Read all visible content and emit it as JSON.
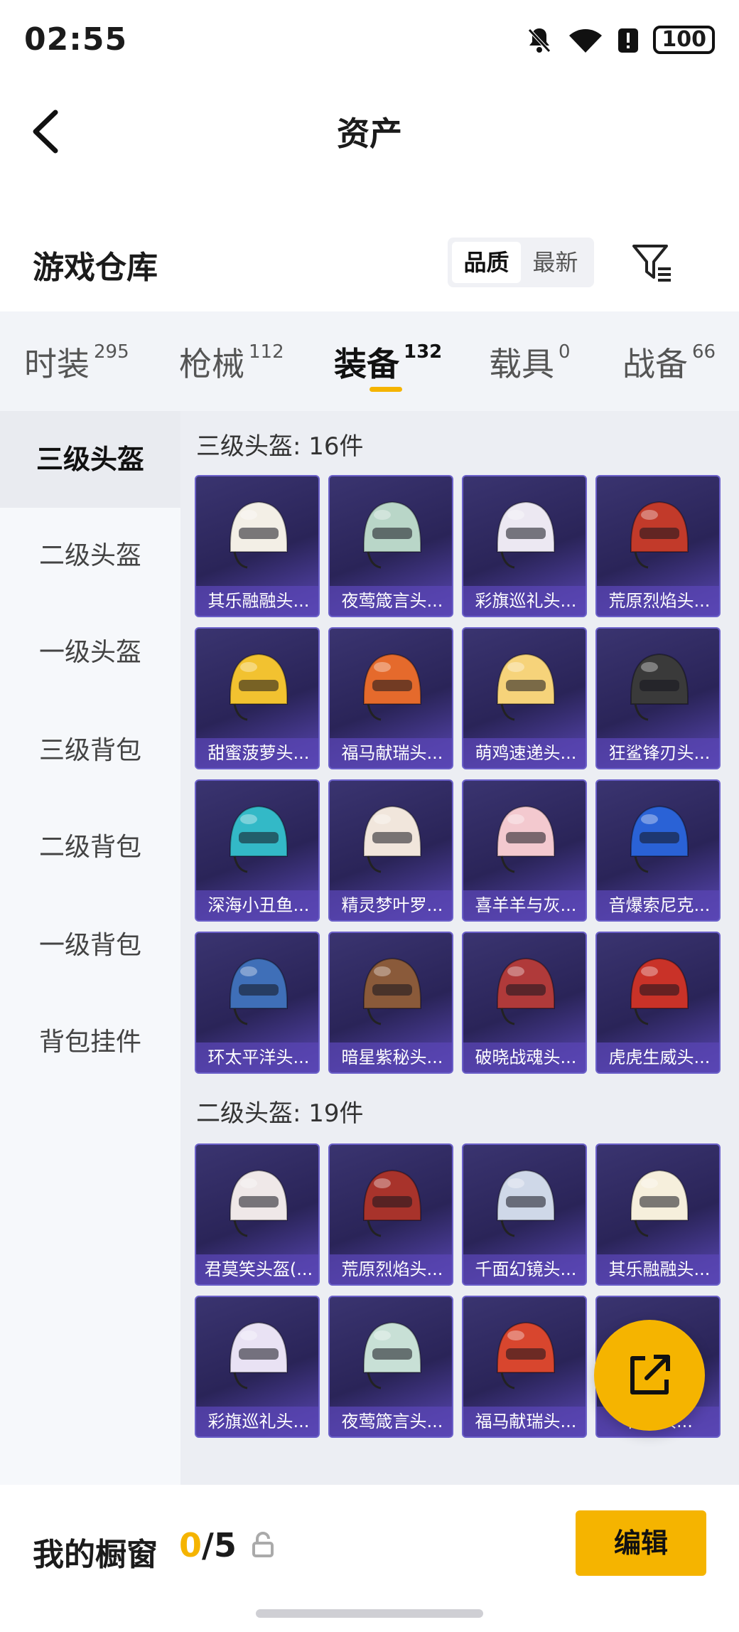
{
  "status_bar": {
    "time": "02:55",
    "battery": "100"
  },
  "header": {
    "title": "资产"
  },
  "section": {
    "title": "游戏仓库",
    "sort_options": [
      "品质",
      "最新"
    ],
    "sort_active": "品质"
  },
  "tabs": [
    {
      "label": "时装",
      "count": "295"
    },
    {
      "label": "枪械",
      "count": "112"
    },
    {
      "label": "装备",
      "count": "132",
      "active": true
    },
    {
      "label": "载具",
      "count": "0"
    },
    {
      "label": "战备",
      "count": "66"
    }
  ],
  "sidebar": [
    {
      "label": "三级头盔",
      "active": true
    },
    {
      "label": "二级头盔"
    },
    {
      "label": "一级头盔"
    },
    {
      "label": "三级背包"
    },
    {
      "label": "二级背包"
    },
    {
      "label": "一级背包"
    },
    {
      "label": "背包挂件"
    }
  ],
  "groups": [
    {
      "title": "三级头盔: 16件",
      "items": [
        {
          "name": "其乐融融头...",
          "color": "#f3efe6"
        },
        {
          "name": "夜莺箴言头...",
          "color": "#b9d6c8"
        },
        {
          "name": "彩旗巡礼头...",
          "color": "#ece8f2"
        },
        {
          "name": "荒原烈焰头...",
          "color": "#c23a2a"
        },
        {
          "name": "甜蜜菠萝头...",
          "color": "#f2c230"
        },
        {
          "name": "福马献瑞头...",
          "color": "#e56a2c"
        },
        {
          "name": "萌鸡速递头...",
          "color": "#f6d37a"
        },
        {
          "name": "狂鲨锋刃头...",
          "color": "#3a3a3a"
        },
        {
          "name": "深海小丑鱼...",
          "color": "#33b9c7"
        },
        {
          "name": "精灵梦叶罗...",
          "color": "#f1e6dc"
        },
        {
          "name": "喜羊羊与灰...",
          "color": "#f3c9cf"
        },
        {
          "name": "音爆索尼克...",
          "color": "#2a62d6"
        },
        {
          "name": "环太平洋头...",
          "color": "#3f6fb8"
        },
        {
          "name": "暗星紫秘头...",
          "color": "#8a5a3a"
        },
        {
          "name": "破晓战魂头...",
          "color": "#b03a3a"
        },
        {
          "name": "虎虎生威头...",
          "color": "#c93228"
        }
      ]
    },
    {
      "title": "二级头盔: 19件",
      "items": [
        {
          "name": "君莫笑头盔(...",
          "color": "#efe8e8"
        },
        {
          "name": "荒原烈焰头...",
          "color": "#a8332b"
        },
        {
          "name": "千面幻镜头...",
          "color": "#cfd8e8"
        },
        {
          "name": "其乐融融头...",
          "color": "#f6efdc"
        },
        {
          "name": "彩旗巡礼头...",
          "color": "#e9e2f4"
        },
        {
          "name": "夜莺箴言头...",
          "color": "#c8e0d6"
        },
        {
          "name": "福马献瑞头...",
          "color": "#d8462e"
        },
        {
          "name": "松...头...",
          "color": "#d8d8d8"
        }
      ]
    }
  ],
  "bottom": {
    "label": "我的橱窗",
    "current": "0",
    "total": "/5",
    "edit": "编辑"
  },
  "icons": [
    "back-arrow-icon",
    "filter-icon",
    "share-icon",
    "lock-icon",
    "bell-off-icon",
    "wifi-icon",
    "alert-icon"
  ]
}
